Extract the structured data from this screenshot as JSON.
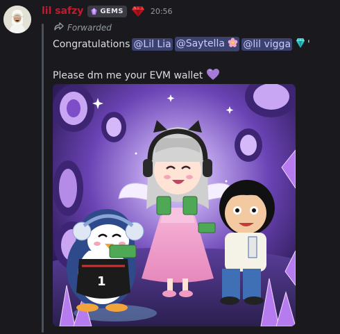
{
  "message": {
    "author": "lil safzy",
    "tag": "GEMS",
    "timestamp": "20:56",
    "forwarded_label": "Forwarded",
    "line1": {
      "prefix": "Congratulations",
      "mentions": [
        "@Lil Lia",
        "@Saytella",
        "@lil vigga"
      ],
      "suffix": "'"
    },
    "line2": "Please dm me your EVM wallet"
  },
  "icons": {
    "tag_icon": "crystal-gem-icon",
    "badge_icon": "red-gem-badge-icon",
    "forward_icon": "forward-arrow-icon",
    "heart_icon": "purple-heart-icon",
    "flower_icon": "cherry-blossom-icon",
    "gem_icon": "teal-gem-icon"
  },
  "colors": {
    "author": "#c21a2f",
    "mention_bg": "#3c4270",
    "mention_text": "#c9cdfb",
    "background": "#1a1a1e"
  }
}
